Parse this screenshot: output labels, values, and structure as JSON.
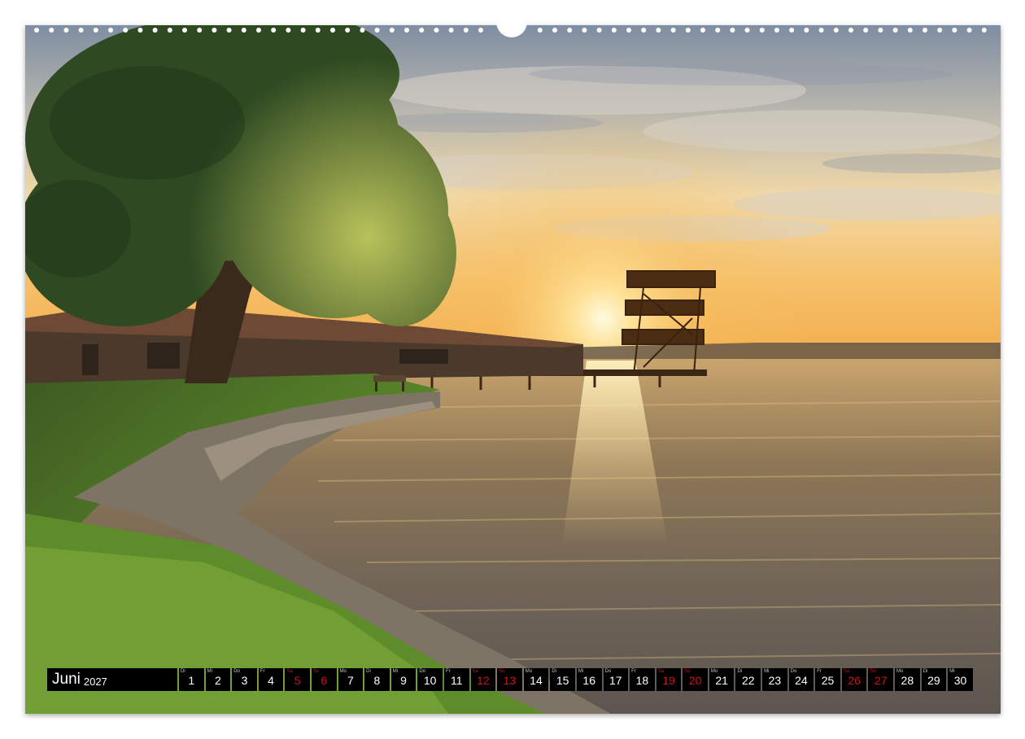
{
  "calendar": {
    "month": "Juni",
    "year": "2027",
    "days": [
      {
        "abbr": "Di",
        "num": "1",
        "weekend": false
      },
      {
        "abbr": "Mi",
        "num": "2",
        "weekend": false
      },
      {
        "abbr": "Do",
        "num": "3",
        "weekend": false
      },
      {
        "abbr": "Fr",
        "num": "4",
        "weekend": false
      },
      {
        "abbr": "Sa",
        "num": "5",
        "weekend": true
      },
      {
        "abbr": "So",
        "num": "6",
        "weekend": true
      },
      {
        "abbr": "Mo",
        "num": "7",
        "weekend": false
      },
      {
        "abbr": "Di",
        "num": "8",
        "weekend": false
      },
      {
        "abbr": "Mi",
        "num": "9",
        "weekend": false
      },
      {
        "abbr": "Do",
        "num": "10",
        "weekend": false
      },
      {
        "abbr": "Fr",
        "num": "11",
        "weekend": false
      },
      {
        "abbr": "Sa",
        "num": "12",
        "weekend": true
      },
      {
        "abbr": "So",
        "num": "13",
        "weekend": true
      },
      {
        "abbr": "Mo",
        "num": "14",
        "weekend": false
      },
      {
        "abbr": "Di",
        "num": "15",
        "weekend": false
      },
      {
        "abbr": "Mi",
        "num": "16",
        "weekend": false
      },
      {
        "abbr": "Do",
        "num": "17",
        "weekend": false
      },
      {
        "abbr": "Fr",
        "num": "18",
        "weekend": false
      },
      {
        "abbr": "Sa",
        "num": "19",
        "weekend": true
      },
      {
        "abbr": "So",
        "num": "20",
        "weekend": true
      },
      {
        "abbr": "Mo",
        "num": "21",
        "weekend": false
      },
      {
        "abbr": "Di",
        "num": "22",
        "weekend": false
      },
      {
        "abbr": "Mi",
        "num": "23",
        "weekend": false
      },
      {
        "abbr": "Do",
        "num": "24",
        "weekend": false
      },
      {
        "abbr": "Fr",
        "num": "25",
        "weekend": false
      },
      {
        "abbr": "Sa",
        "num": "26",
        "weekend": true
      },
      {
        "abbr": "So",
        "num": "27",
        "weekend": true
      },
      {
        "abbr": "Mo",
        "num": "28",
        "weekend": false
      },
      {
        "abbr": "Di",
        "num": "29",
        "weekend": false
      },
      {
        "abbr": "Mi",
        "num": "30",
        "weekend": false
      }
    ]
  },
  "colors": {
    "weekend": "#d0101a",
    "bar_background": "#000000",
    "text": "#ffffff"
  }
}
